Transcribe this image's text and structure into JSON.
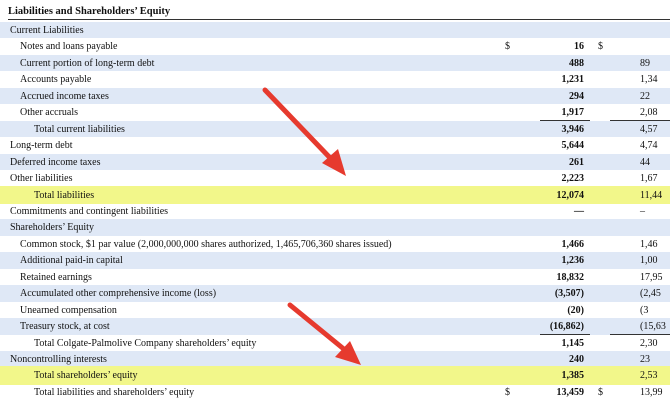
{
  "title": "Liabilities and Shareholders’ Equity",
  "currency_symbol": "$",
  "rows": [
    {
      "label": "Current Liabilities",
      "indent": 0,
      "v1": "",
      "v2": "",
      "band": true
    },
    {
      "label": "Notes and loans payable",
      "indent": 1,
      "v1": "16",
      "v2": "",
      "dollar1": true,
      "dollar2": true
    },
    {
      "label": "Current portion of long-term debt",
      "indent": 1,
      "v1": "488",
      "v2": "89",
      "band": true
    },
    {
      "label": "Accounts payable",
      "indent": 1,
      "v1": "1,231",
      "v2": "1,34"
    },
    {
      "label": "Accrued income taxes",
      "indent": 1,
      "v1": "294",
      "v2": "22",
      "band": true
    },
    {
      "label": "Other accruals",
      "indent": 1,
      "v1": "1,917",
      "v2": "2,08"
    },
    {
      "label": "Total current liabilities",
      "indent": 2,
      "v1": "3,946",
      "v2": "4,57",
      "band": true
    },
    {
      "label": "Long-term debt",
      "indent": 0,
      "v1": "5,644",
      "v2": "4,74"
    },
    {
      "label": "Deferred income taxes",
      "indent": 0,
      "v1": "261",
      "v2": "44",
      "band": true
    },
    {
      "label": "Other liabilities",
      "indent": 0,
      "v1": "2,223",
      "v2": "1,67"
    },
    {
      "label": "Total liabilities",
      "indent": 2,
      "v1": "12,074",
      "v2": "11,44",
      "highlight": true
    },
    {
      "label": "Commitments and contingent liabilities",
      "indent": 0,
      "v1": "—",
      "v2": "–"
    },
    {
      "label": "Shareholders’ Equity",
      "indent": 0,
      "v1": "",
      "v2": "",
      "band": true
    },
    {
      "label": "Common stock, $1 par value (2,000,000,000 shares authorized, 1,465,706,360 shares issued)",
      "indent": 1,
      "v1": "1,466",
      "v2": "1,46"
    },
    {
      "label": "Additional paid-in capital",
      "indent": 1,
      "v1": "1,236",
      "v2": "1,00",
      "band": true
    },
    {
      "label": "Retained earnings",
      "indent": 1,
      "v1": "18,832",
      "v2": "17,95"
    },
    {
      "label": "Accumulated other comprehensive income (loss)",
      "indent": 1,
      "v1": "(3,507)",
      "v2": "(2,45",
      "band": true
    },
    {
      "label": "Unearned compensation",
      "indent": 1,
      "v1": "(20)",
      "v2": "(3"
    },
    {
      "label": "Treasury stock, at cost",
      "indent": 1,
      "v1": "(16,862)",
      "v2": "(15,63",
      "band": true
    },
    {
      "label": "Total Colgate-Palmolive Company shareholders’ equity",
      "indent": 2,
      "v1": "1,145",
      "v2": "2,30"
    },
    {
      "label": "Noncontrolling interests",
      "indent": 0,
      "v1": "240",
      "v2": "23",
      "band": true
    },
    {
      "label": "Total shareholders’ equity",
      "indent": 2,
      "v1": "1,385",
      "v2": "2,53",
      "highlight": true
    },
    {
      "label": "Total liabilities and shareholders’ equity",
      "indent": 2,
      "v1": "13,459",
      "v2": "13,99",
      "dollar1": true,
      "dollar2": true
    }
  ]
}
